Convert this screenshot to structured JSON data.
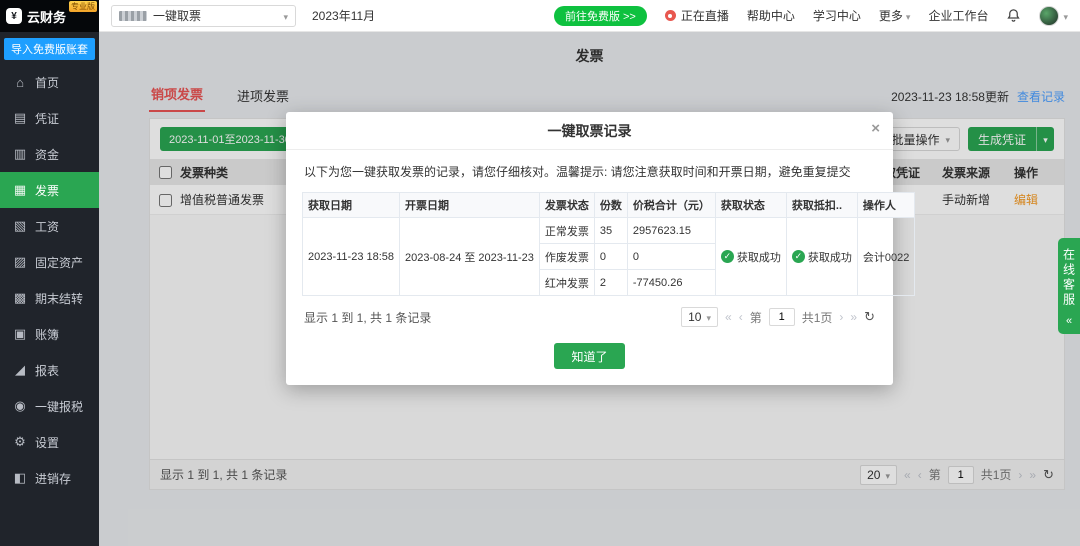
{
  "header": {
    "logo_text": "云财务",
    "logo_badge": "专业版",
    "account_select_value": "一键取票",
    "period": "2023年11月",
    "free_btn": "前往免费版 >>",
    "live": "正在直播",
    "help": "帮助中心",
    "study": "学习中心",
    "more": "更多",
    "workbench": "企业工作台"
  },
  "sidebar": {
    "import_btn": "导入免费版账套",
    "items": [
      {
        "label": "首页",
        "icon": "home-icon",
        "glyph": "⌂"
      },
      {
        "label": "凭证",
        "icon": "voucher-icon",
        "glyph": "▤"
      },
      {
        "label": "资金",
        "icon": "funds-icon",
        "glyph": "▥"
      },
      {
        "label": "发票",
        "icon": "invoice-icon",
        "glyph": "▦",
        "active": true
      },
      {
        "label": "工资",
        "icon": "salary-icon",
        "glyph": "▧"
      },
      {
        "label": "固定资产",
        "icon": "fixed-assets-icon",
        "glyph": "▨"
      },
      {
        "label": "期末结转",
        "icon": "carryover-icon",
        "glyph": "▩"
      },
      {
        "label": "账簿",
        "icon": "ledger-icon",
        "glyph": "▣"
      },
      {
        "label": "报表",
        "icon": "report-icon",
        "glyph": "◢"
      },
      {
        "label": "一键报税",
        "icon": "tax-icon",
        "glyph": "◉"
      },
      {
        "label": "设置",
        "icon": "settings-icon",
        "glyph": "⚙"
      },
      {
        "label": "进销存",
        "icon": "inventory-icon",
        "glyph": "◧"
      }
    ]
  },
  "page": {
    "title": "发票",
    "tabs": [
      {
        "label": "销项发票",
        "active": true
      },
      {
        "label": "进项发票",
        "active": false
      }
    ],
    "updated": "2023-11-23 18:58更新",
    "view_records": "查看记录",
    "date_range": "2023-11-01至2023-11-30",
    "batch_btn": "批量操作",
    "gen_voucher_btn": "生成凭证",
    "table": {
      "headers": {
        "type": "发票种类",
        "voucher": "取凭证",
        "source": "发票来源",
        "action": "操作"
      },
      "row": {
        "type": "增值税普通发票",
        "source": "手动新增",
        "action": "编辑"
      }
    },
    "pagination": {
      "summary": "显示 1 到 1, 共 1 条记录",
      "page_size": "20",
      "page_prefix": "第",
      "page_num": "1",
      "page_total": "共1页"
    }
  },
  "modal": {
    "title": "一键取票记录",
    "close": "×",
    "description": "以下为您一键获取发票的记录，请您仔细核对。温馨提示: 请您注意获取时间和开票日期，避免重复提交",
    "table": {
      "headers": [
        "获取日期",
        "开票日期",
        "发票状态",
        "份数",
        "价税合计（元）",
        "获取状态",
        "获取抵扣..",
        "操作人"
      ],
      "get_date": "2023-11-23 18:58",
      "invoice_date": "2023-08-24 至 2023-11-23",
      "rows": [
        {
          "status": "正常发票",
          "count": "35",
          "amount": "2957623.15"
        },
        {
          "status": "作废发票",
          "count": "0",
          "amount": "0"
        },
        {
          "status": "红冲发票",
          "count": "2",
          "amount": "-77450.26"
        }
      ],
      "fetch_status": "获取成功",
      "deduct_status": "获取成功",
      "operator": "会计0022"
    },
    "pagination": {
      "summary": "显示 1 到 1, 共 1 条记录",
      "page_size": "10",
      "page_prefix": "第",
      "page_num": "1",
      "page_total": "共1页"
    },
    "confirm_btn": "知道了"
  },
  "floating": {
    "service": "在线客服",
    "collapse": "«"
  },
  "colors": {
    "green": "#2aa652",
    "bright_green": "#0ec13f",
    "blue": "#1e9fff",
    "link_blue": "#4a9eff",
    "tab_red": "#e85353",
    "orange": "#f59a23",
    "sidebar_bg": "#20242b"
  }
}
